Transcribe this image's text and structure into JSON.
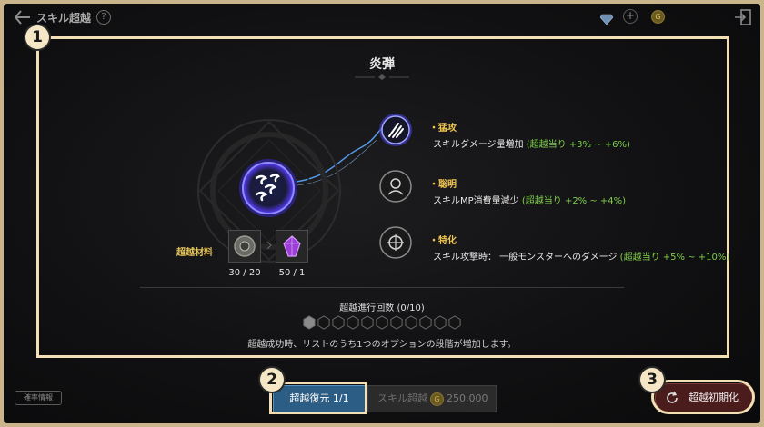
{
  "header": {
    "title": "スキル超越",
    "help_icon": "?",
    "plus": "+",
    "coin_symbol": "G"
  },
  "badges": {
    "one": "1",
    "two": "2",
    "three": "3"
  },
  "skill": {
    "name": "炎弾"
  },
  "materials": {
    "label": "超越材料",
    "items": [
      {
        "icon": "gear-stone-icon",
        "count": "30 / 20"
      },
      {
        "icon": "purple-crystal-icon",
        "count": "50 / 1"
      }
    ]
  },
  "options": [
    {
      "icon": "claw-slash-icon",
      "name": "・猛攻",
      "desc": "スキルダメージ量増加",
      "bonus": "(超越当り +3% ~ +6%)"
    },
    {
      "icon": "wisdom-head-icon",
      "name": "・聡明",
      "desc": "スキルMP消費量減少",
      "bonus": "(超越当り +2% ~ +4%)"
    },
    {
      "icon": "specialize-icon",
      "name": "・特化",
      "desc": "スキル攻撃時： 一般モンスターへのダメージ",
      "bonus": "(超越当り +5% ~ +10%)"
    }
  ],
  "progress": {
    "label": "超越進行回数 (0/10)",
    "current": 0,
    "total": 10,
    "info": "超越成功時、リストのうち1つのオプションの段階が増加します。"
  },
  "footer": {
    "probability_label": "確率情報",
    "restore_label": "超越復元 1/1",
    "transcend_label": "スキル超越",
    "transcend_cost": "250,000",
    "reset_label": "超越初期化"
  },
  "colors": {
    "highlight": "#f3dfb5",
    "gold_text": "#f0c54e",
    "bonus_green": "#7fcf4a",
    "restore_blue": "#2c5d84",
    "reset_red": "#4a1c1c"
  }
}
